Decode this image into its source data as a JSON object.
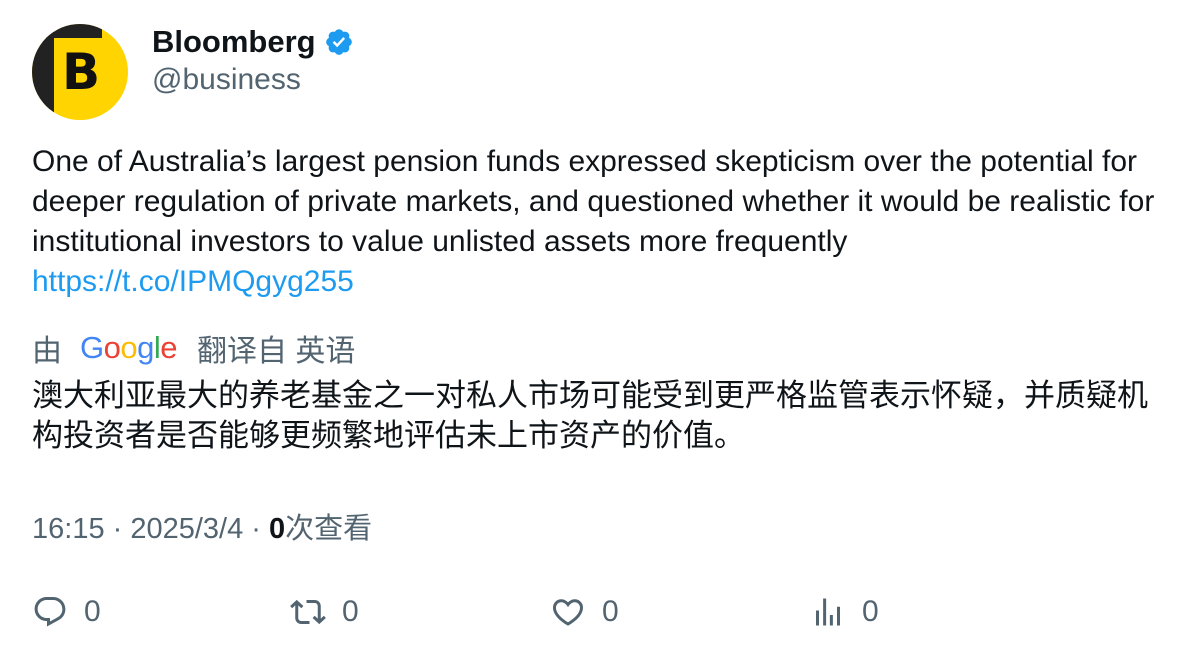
{
  "author": {
    "display_name": "Bloomberg",
    "handle": "@business",
    "avatar_letter": "B",
    "verified_icon": "verified-badge-icon",
    "verified_color": "#1d9bf0",
    "avatar_color": "#ffd400"
  },
  "tweet": {
    "text": "One of Australia’s largest pension funds expressed skepticism over the potential for deeper regulation of private markets, and questioned whether it would be realistic for institutional investors to value unlisted assets more frequently ",
    "link": "https://t.co/IPMQgyg255",
    "link_color": "#1d9bf0"
  },
  "translation": {
    "prefix": "由",
    "provider": "Google",
    "suffix": "翻译自 英语",
    "text": "澳大利亚最大的养老基金之一对私人市场可能受到更严格监管表示怀疑，并质疑机构投资者是否能够更频繁地评估未上市资产的价值。"
  },
  "meta": {
    "time": "16:15",
    "separator1": " · ",
    "date": "2025/3/4",
    "separator2": " · ",
    "views_count": "0",
    "views_label": "次查看"
  },
  "actions": {
    "reply": {
      "icon": "reply-icon",
      "count": "0"
    },
    "retweet": {
      "icon": "retweet-icon",
      "count": "0"
    },
    "like": {
      "icon": "heart-icon",
      "count": "0"
    },
    "views": {
      "icon": "analytics-icon",
      "count": "0"
    }
  }
}
